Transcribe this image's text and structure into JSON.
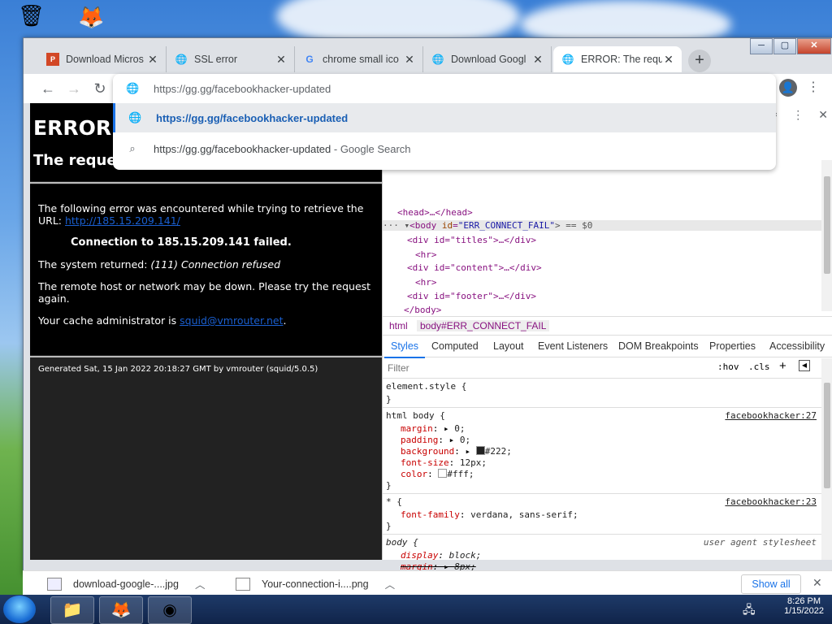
{
  "browser": {
    "tabs": [
      {
        "title": "Download Micros",
        "favicon": "powerpoint-icon"
      },
      {
        "title": "SSL error",
        "favicon": "globe-icon"
      },
      {
        "title": "chrome small ico",
        "favicon": "google-icon"
      },
      {
        "title": "Download Googl",
        "favicon": "globe-icon"
      },
      {
        "title": "ERROR: The requ",
        "favicon": "globe-icon"
      }
    ],
    "address_value": "https://gg.gg/facebookhacker-updated",
    "suggestions": [
      {
        "text": "https://gg.gg/facebookhacker-updated",
        "suffix": ""
      },
      {
        "text": "https://gg.gg/facebookhacker-updated",
        "suffix": " - Google Search"
      }
    ]
  },
  "page": {
    "h1": "ERROR",
    "h2": "The reque",
    "p1_text": "The following error was encountered while trying to retrieve the URL: ",
    "p1_link": "http://185.15.209.141/",
    "p2_strong": "Connection to 185.15.209.141 failed.",
    "p3_prefix": "The system returned: ",
    "p3_em": "(111) Connection refused",
    "p4": "The remote host or network may be down. Please try the request again.",
    "p5_prefix": "Your cache administrator is ",
    "p5_link": "squid@vmrouter.net",
    "p5_suffix": ".",
    "footer": "Generated Sat, 15 Jan 2022 20:18:27 GMT by vmrouter (squid/5.0.5)"
  },
  "devtools": {
    "dom": {
      "head": "<head>…</head>",
      "body_open": "<body",
      "body_attr": "id",
      "body_val": "\"ERR_CONNECT_FAIL\"",
      "body_eq": "> == $0",
      "div_titles": "<div id=\"titles\">…</div>",
      "hr": "<hr>",
      "div_content": "<div id=\"content\">…</div>",
      "div_footer": "<div id=\"footer\">…</div>",
      "body_close": "</body>"
    },
    "breadcrumbs": [
      "html",
      "body#ERR_CONNECT_FAIL"
    ],
    "tabs": [
      "Styles",
      "Computed",
      "Layout",
      "Event Listeners",
      "DOM Breakpoints",
      "Properties",
      "Accessibility"
    ],
    "filter_placeholder": "Filter",
    "hov": ":hov",
    "cls": ".cls",
    "rules": {
      "element_style": "element.style {",
      "close": "}",
      "r1_selector": "html body {",
      "r1_src": "facebookhacker:27",
      "r1_props": [
        {
          "name": "margin",
          "value": "0;"
        },
        {
          "name": "padding",
          "value": "0;"
        },
        {
          "name": "background",
          "value": "#222;"
        },
        {
          "name": "font-size",
          "value": "12px;"
        },
        {
          "name": "color",
          "value": "#fff;"
        }
      ],
      "r2_selector": "* {",
      "r2_src": "facebookhacker:23",
      "r2_prop": "font-family",
      "r2_val": "verdana, sans-serif;",
      "r3_selector": "body {",
      "r3_src": "user agent stylesheet",
      "r3_p1": "display",
      "r3_v1": "block;",
      "r3_p2": "margin",
      "r3_v2": "8px;"
    }
  },
  "downloads": {
    "items": [
      "download-google-....jpg",
      "Your-connection-i....png"
    ],
    "show_all": "Show all"
  },
  "taskbar": {
    "time": "8:26 PM",
    "date": "1/15/2022"
  }
}
